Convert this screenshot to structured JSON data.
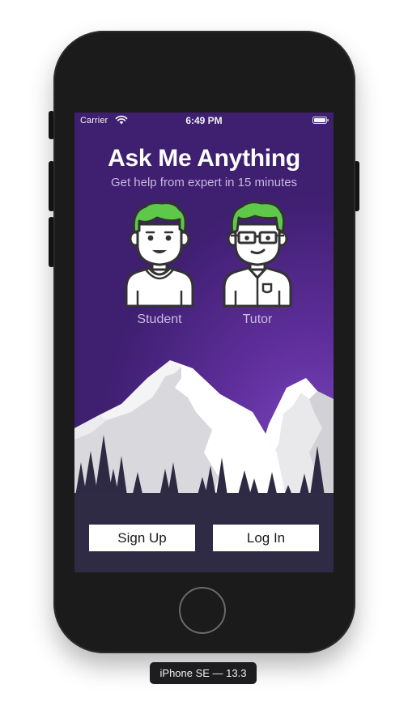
{
  "status_bar": {
    "carrier": "Carrier",
    "time": "6:49 PM",
    "wifi_icon": "wifi-icon",
    "battery_icon": "battery-icon"
  },
  "app": {
    "title": "Ask Me Anything",
    "subtitle": "Get help from expert in 15 minutes",
    "roles": [
      {
        "label": "Student",
        "icon": "student-avatar-icon"
      },
      {
        "label": "Tutor",
        "icon": "tutor-avatar-icon"
      }
    ],
    "buttons": {
      "signup": "Sign Up",
      "login": "Log In"
    }
  },
  "simulator": {
    "device_label": "iPhone SE — 13.3"
  },
  "colors": {
    "background_purple": "#5e2e9a",
    "hair_green": "#5ec84a",
    "ground": "#302b45",
    "snow": "#f4f4f4",
    "trees": "#2f2a44"
  }
}
